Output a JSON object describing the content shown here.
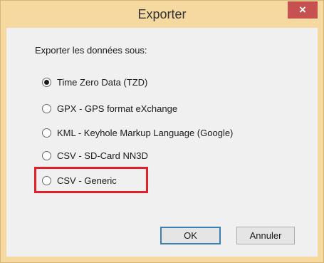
{
  "window": {
    "title": "Exporter",
    "close_label": "×"
  },
  "group_label": "Exporter les données sous:",
  "options": [
    {
      "label": "Time Zero Data (TZD)",
      "checked": true
    },
    {
      "label": "GPX - GPS format eXchange",
      "checked": false
    },
    {
      "label": "KML - Keyhole Markup Language (Google)",
      "checked": false
    },
    {
      "label": "CSV - SD-Card NN3D",
      "checked": false
    },
    {
      "label": "CSV - Generic",
      "checked": false
    }
  ],
  "buttons": {
    "ok_label": "OK",
    "cancel_label": "Annuler"
  },
  "colors": {
    "title_bar": "#f5d9a0",
    "close_button": "#c75050",
    "highlight": "#e0202a"
  }
}
